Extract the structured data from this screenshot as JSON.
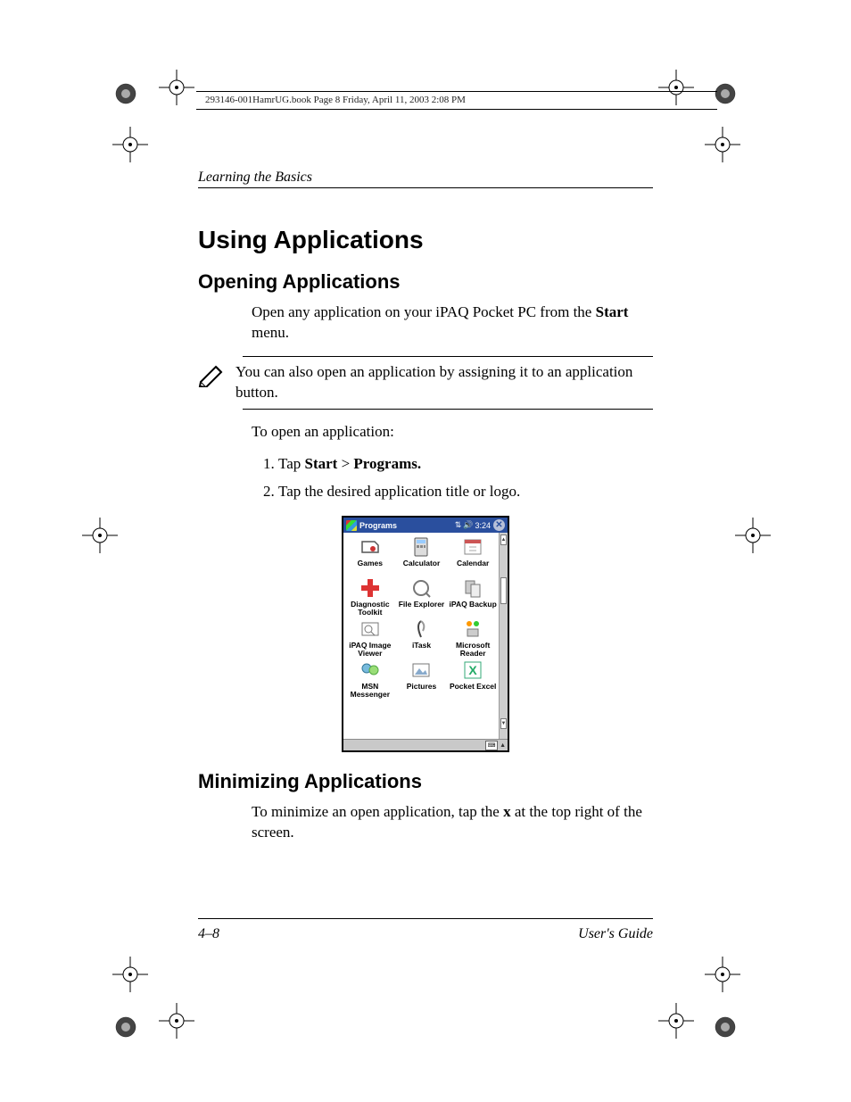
{
  "crop_header": "293146-001HamrUG.book  Page 8  Friday, April 11, 2003  2:08 PM",
  "running_head": "Learning the Basics",
  "h1": "Using Applications",
  "h2a": "Opening Applications",
  "p_intro_a": "Open any application on your iPAQ Pocket PC from the ",
  "p_intro_b": "Start",
  "p_intro_c": " menu.",
  "note": "You can also open an application by assigning it to an application button.",
  "p_toopen": "To open an application:",
  "steps": {
    "s1a": "Tap ",
    "s1b": "Start",
    "s1c": " > ",
    "s1d": "Programs.",
    "s2": "Tap the desired application title or logo."
  },
  "device": {
    "title": "Programs",
    "time": "3:24",
    "apps": [
      {
        "label": "Games"
      },
      {
        "label": "Calculator"
      },
      {
        "label": "Calendar"
      },
      {
        "label": "Diagnostic Toolkit"
      },
      {
        "label": "File Explorer"
      },
      {
        "label": "iPAQ Backup"
      },
      {
        "label": "iPAQ Image Viewer"
      },
      {
        "label": "iTask"
      },
      {
        "label": "Microsoft Reader"
      },
      {
        "label": "MSN Messenger"
      },
      {
        "label": "Pictures"
      },
      {
        "label": "Pocket Excel"
      }
    ]
  },
  "h2b": "Minimizing Applications",
  "p_min_a": "To minimize an open application, tap the ",
  "p_min_b": "x",
  "p_min_c": " at the top right of the screen.",
  "footer_left": "4–8",
  "footer_right": "User's Guide"
}
